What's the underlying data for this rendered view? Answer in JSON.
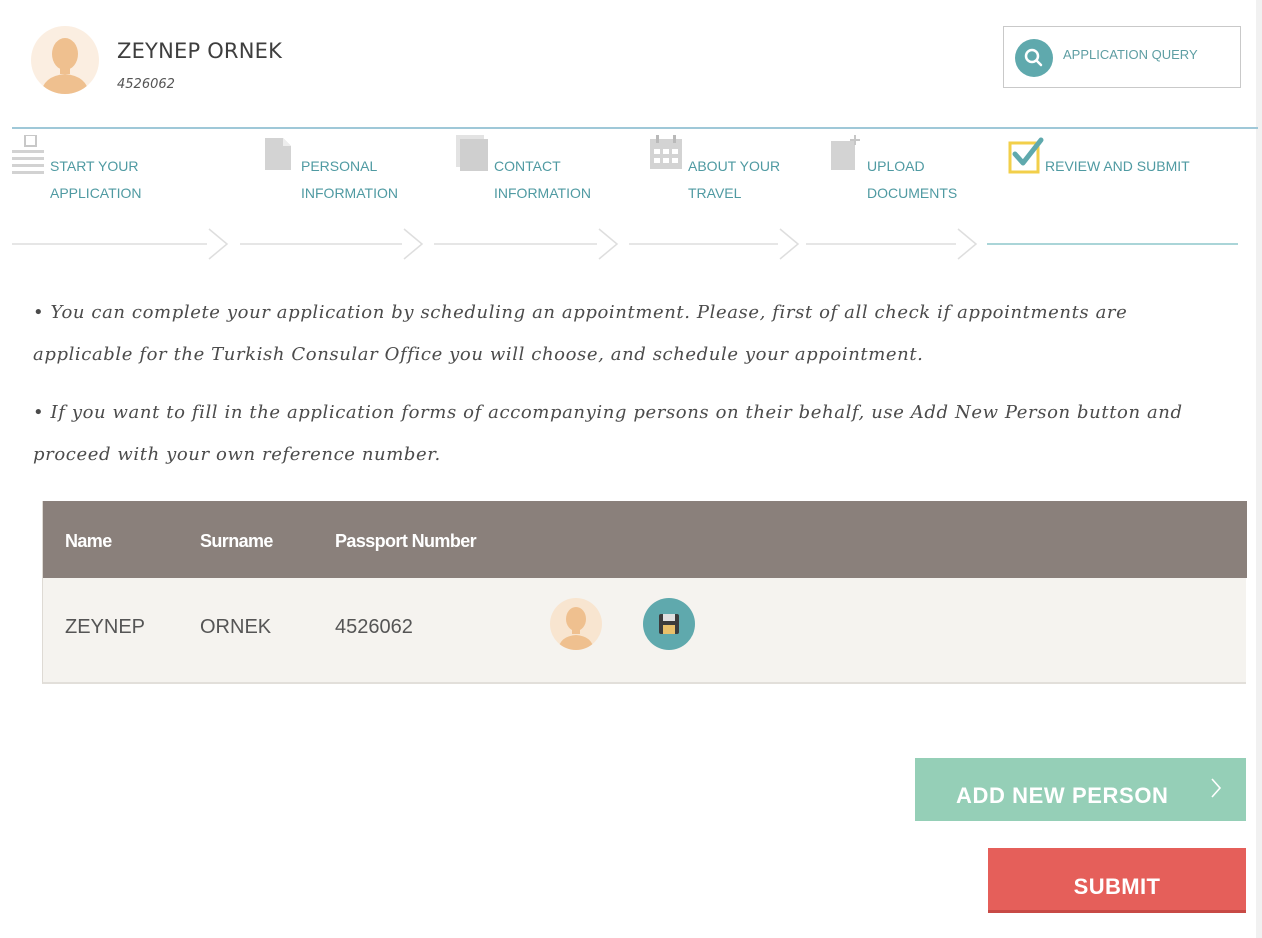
{
  "header": {
    "user_name": "ZEYNEP ORNEK",
    "user_reference": "4526062",
    "query_button_label": "APPLICATION QUERY"
  },
  "steps": [
    {
      "label": "START YOUR\nAPPLICATION",
      "icon": "form-icon"
    },
    {
      "label": "PERSONAL\nINFORMATION",
      "icon": "document-icon"
    },
    {
      "label": "CONTACT\nINFORMATION",
      "icon": "documents-icon"
    },
    {
      "label": "ABOUT YOUR\nTRAVEL",
      "icon": "calendar-icon"
    },
    {
      "label": "UPLOAD\nDOCUMENTS",
      "icon": "upload-icon"
    },
    {
      "label": "REVIEW AND SUBMIT",
      "icon": "checkbox-icon",
      "active": true
    }
  ],
  "info": {
    "line1": "• You can complete your application by scheduling an appointment. Please, first of all check if appointments are applicable for the Turkish Consular Office you will choose, and schedule your appointment.",
    "line2": "•  If you want to fill in the application forms of accompanying persons on their behalf, use Add New Person button and proceed with your own reference number."
  },
  "table": {
    "headers": {
      "name": "Name",
      "surname": "Surname",
      "passport": "Passport Number"
    },
    "rows": [
      {
        "name": "ZEYNEP",
        "surname": "ORNEK",
        "passport": "4526062"
      }
    ]
  },
  "buttons": {
    "add_new_person": "ADD NEW PERSON",
    "submit": "SUBMIT"
  },
  "colors": {
    "teal_accent": "#5fa9ad",
    "table_header": "#8a807b",
    "add_button": "#95cfb7",
    "submit_button": "#e55f5a",
    "active_step_icon": "#f2cf4a"
  }
}
